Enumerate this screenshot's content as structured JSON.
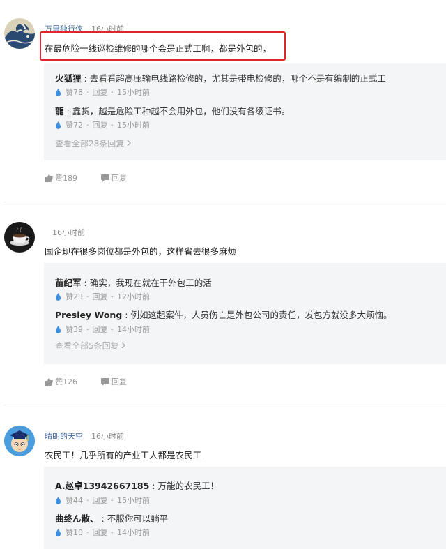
{
  "comments": [
    {
      "author": "万里独行侠",
      "time": "16小时前",
      "content": "在最危险一线巡检维修的哪个会是正式工啊，都是外包的，",
      "replies": [
        {
          "name": "火狐狸",
          "text": "去看看超高压输电线路检修的，尤其是带电检修的，哪个不是有编制的正式工",
          "likes": "赞78",
          "reply": "回复",
          "time": "15小时前"
        },
        {
          "name": "龍",
          "text": "鑫货，越是危险工种越不会用外包，他们没有各级证书。",
          "likes": "赞72",
          "reply": "回复",
          "time": "15小时前"
        }
      ],
      "more": "查看全部28条回复",
      "likes": "赞189",
      "reply": "回复"
    },
    {
      "author": "",
      "time": "16小时前",
      "content": "国企现在很多岗位都是外包的，这样省去很多麻烦",
      "replies": [
        {
          "name": "苗纪军",
          "text": "确实，我现在就在干外包工的活",
          "likes": "赞23",
          "reply": "回复",
          "time": "12小时前"
        },
        {
          "name": "Presley Wong",
          "text": "例如这起案件，人员伤亡是外包公司的责任，发包方就没多大烦恼。",
          "likes": "赞39",
          "reply": "回复",
          "time": "14小时前"
        }
      ],
      "more": "查看全部5条回复",
      "likes": "赞126",
      "reply": "回复"
    },
    {
      "author": "晴朗的天空",
      "time": "16小时前",
      "content": "农民工！几乎所有的产业工人都是农民工",
      "replies": [
        {
          "name": "A.赵卓13942667185",
          "text": "万能的农民工！",
          "likes": "赞44",
          "reply": "回复",
          "time": "15小时前"
        },
        {
          "name": "曲终ん散、",
          "text": "不服你可以躺平",
          "likes": "赞10",
          "reply": "回复",
          "time": "14小时前"
        }
      ]
    }
  ],
  "colors": {
    "author": "#406599",
    "highlight_border": "#e0262b",
    "reply_bg": "#f4f5f7",
    "drop": "#3d8fe0"
  },
  "icons": [
    "wave-avatar",
    "coffee-cup-avatar",
    "graduate-cartoon-avatar",
    "water-drop-icon",
    "thumbs-up-icon",
    "speech-bubble-icon",
    "chevron-right-icon"
  ]
}
